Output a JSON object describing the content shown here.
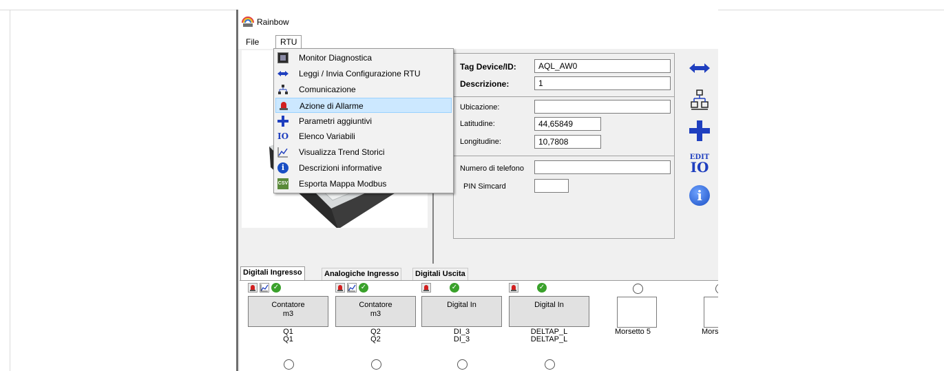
{
  "window": {
    "title": "Rainbow"
  },
  "menubar": {
    "file": "File",
    "rtu": "RTU"
  },
  "rtu_menu": [
    {
      "label": "Monitor Diagnostica",
      "icon": "monitor-icon"
    },
    {
      "label": "Leggi / Invia Configurazione RTU",
      "icon": "transfer-arrows-icon"
    },
    {
      "label": "Comunicazione",
      "icon": "network-icon"
    },
    {
      "label": "Azione di Allarme",
      "icon": "alarm-icon",
      "highlighted": true
    },
    {
      "label": "Parametri aggiuntivi",
      "icon": "plus-icon"
    },
    {
      "label": "Elenco Variabili",
      "icon": "io-list-icon"
    },
    {
      "label": "Visualizza Trend Storici",
      "icon": "trend-chart-icon"
    },
    {
      "label": "Descrizioni informative",
      "icon": "info-icon"
    },
    {
      "label": "Esporta Mappa Modbus",
      "icon": "csv-icon"
    }
  ],
  "form": {
    "tag_label": "Tag Device/ID:",
    "tag_value": "AQL_AW0",
    "desc_label": "Descrizione:",
    "desc_value": "1",
    "ubicazione_label": "Ubicazione:",
    "ubicazione_value": "",
    "latitudine_label": "Latitudine:",
    "latitudine_value": "44,65849",
    "longitudine_label": "Longitudine:",
    "longitudine_value": "10,7808",
    "telefono_label": "Numero di telefono",
    "telefono_value": "",
    "pin_label": "PIN Simcard",
    "pin_value": ""
  },
  "right_buttons": [
    {
      "name": "transfer-button",
      "icon": "double-arrow-icon"
    },
    {
      "name": "network-button",
      "icon": "network-icon"
    },
    {
      "name": "add-button",
      "icon": "plus-icon"
    },
    {
      "name": "edit-io-button",
      "icon": "edit-io-icon",
      "text": "EDIT",
      "text2": "IO"
    },
    {
      "name": "info-button",
      "icon": "info-icon",
      "text": "i"
    }
  ],
  "tabs": [
    "Digitali Ingresso",
    "Analogiche Ingresso",
    "Digitali Uscita"
  ],
  "channels": [
    {
      "line1": "Contatore",
      "line2": "m3",
      "id1": "Q1",
      "id2": "Q1",
      "icons": [
        "alarm-icon",
        "trend-chart-icon",
        "check-icon"
      ]
    },
    {
      "line1": "Contatore",
      "line2": "m3",
      "id1": "Q2",
      "id2": "Q2",
      "icons": [
        "alarm-icon",
        "trend-chart-icon",
        "check-icon"
      ]
    },
    {
      "line1": "Digital In",
      "line2": "",
      "id1": "DI_3",
      "id2": "DI_3",
      "icons": [
        "alarm-icon",
        "check-icon"
      ]
    },
    {
      "line1": "Digital In",
      "line2": "",
      "id1": "DELTAP_L",
      "id2": "DELTAP_L",
      "icons": [
        "alarm-icon",
        "check-icon"
      ]
    }
  ],
  "empty_channels": [
    "Morsetto 5",
    "Morse"
  ],
  "colors": {
    "accent_blue": "#1f3fbf",
    "highlight": "#cce8ff",
    "check_green": "#3aa12b",
    "alarm_red": "#d21f1f"
  }
}
